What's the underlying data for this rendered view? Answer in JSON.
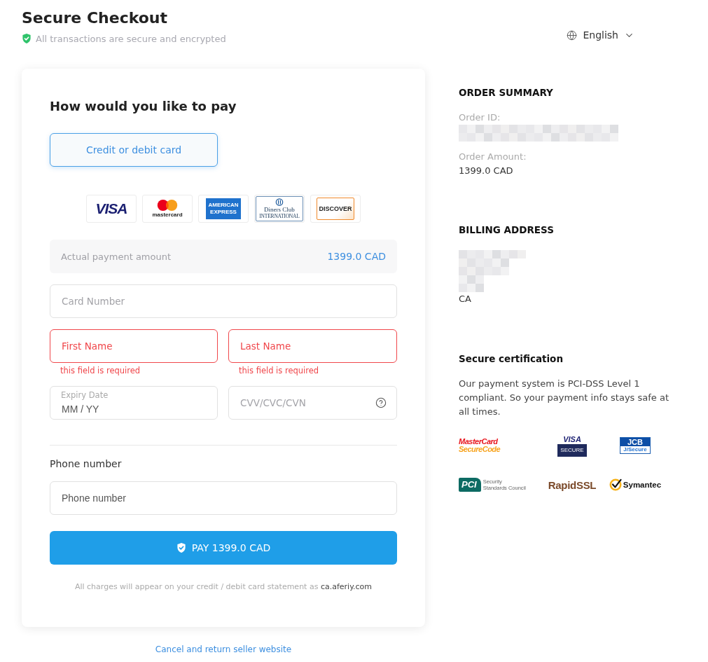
{
  "header": {
    "title": "Secure Checkout",
    "subtitle": "All transactions are secure and encrypted"
  },
  "language": {
    "label": "English"
  },
  "payment": {
    "title": "How would you like to pay",
    "methods": [
      {
        "label": "Credit or debit card",
        "selected": true
      }
    ],
    "card_brands": [
      {
        "kind": "visa",
        "lines": [
          "VISA"
        ]
      },
      {
        "kind": "mastercard",
        "lines": [
          "mastercard"
        ]
      },
      {
        "kind": "amex",
        "lines": [
          "AMERICAN",
          "EXPRESS"
        ]
      },
      {
        "kind": "diners",
        "lines": [
          "Diners Club",
          "INTERNATIONAL"
        ]
      },
      {
        "kind": "discover",
        "lines": [
          "DISCOVER"
        ]
      }
    ],
    "amount": {
      "label": "Actual payment amount",
      "value": "1399.0 CAD"
    },
    "card_number": {
      "placeholder": "Card Number",
      "invalid": false
    },
    "first_name": {
      "placeholder": "First Name",
      "invalid": true,
      "error": "this field is required"
    },
    "last_name": {
      "placeholder": "Last Name",
      "invalid": true,
      "error": "this field is required"
    },
    "expiry": {
      "label": "Expiry Date",
      "placeholder": "MM / YY",
      "invalid": false
    },
    "cvv": {
      "placeholder": "CVV/CVC/CVN",
      "invalid": false
    },
    "phone": {
      "label": "Phone number",
      "placeholder": "Phone number",
      "invalid": false
    },
    "pay_button": {
      "label": "PAY 1399.0 CAD"
    },
    "statement_note": {
      "text": "All charges will appear on your credit / debit card statement as",
      "merchant": "ca.aferiy.com"
    }
  },
  "cancel_link": {
    "label": "Cancel and return seller website"
  },
  "order_summary": {
    "title": "ORDER SUMMARY",
    "items": [
      {
        "label": "Order ID:",
        "kind": "redacted"
      },
      {
        "label": "Order Amount:",
        "kind": "text",
        "value": "1399.0 CAD"
      }
    ]
  },
  "billing_address": {
    "title": "BILLING ADDRESS",
    "lines": [
      {
        "kind": "redacted"
      },
      {
        "kind": "redacted"
      },
      {
        "kind": "text",
        "text": "CA"
      }
    ]
  },
  "secure_certification": {
    "title": "Secure certification",
    "text": "Our payment system is PCI-DSS Level 1 compliant. So your payment info stays safe at all times.",
    "badges": [
      {
        "kind": "mastercard-securecode",
        "lines": [
          "MasterCard",
          "SecureCode"
        ]
      },
      {
        "kind": "visa-secure",
        "lines": [
          "VISA",
          "SECURE"
        ]
      },
      {
        "kind": "jcb-jsecure",
        "lines": [
          "JCB",
          "J/Secure"
        ]
      },
      {
        "kind": "pci",
        "lines": [
          "PCI",
          "Security",
          "Standards Council"
        ]
      },
      {
        "kind": "rapidssl",
        "lines": [
          "RapidSSL"
        ]
      },
      {
        "kind": "symantec",
        "lines": [
          "Symantec"
        ]
      }
    ]
  }
}
